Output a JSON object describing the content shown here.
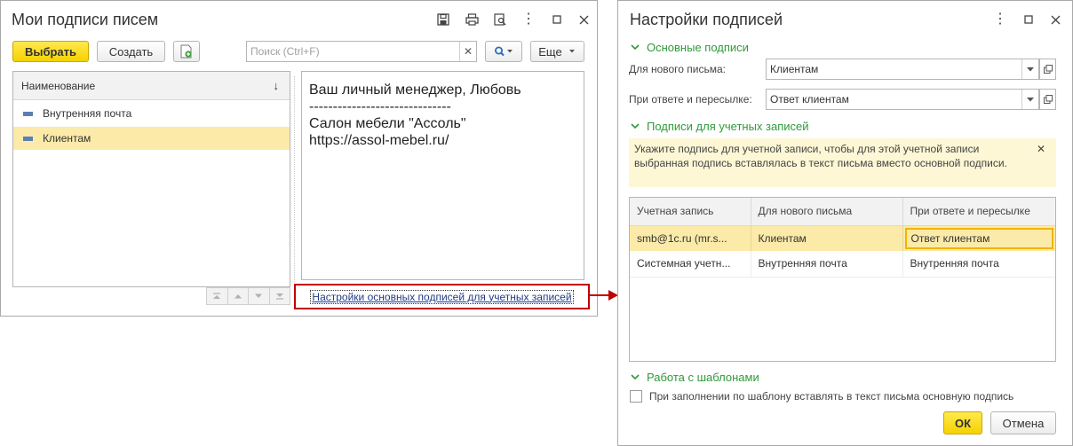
{
  "left_window": {
    "title": "Мои подписи писем",
    "toolbar": {
      "select_label": "Выбрать",
      "create_label": "Создать",
      "search_placeholder": "Поиск (Ctrl+F)",
      "more_label": "Еще"
    },
    "list": {
      "header": "Наименование",
      "items": [
        "Внутренняя почта",
        "Клиентам"
      ],
      "selected_index": 1
    },
    "preview": {
      "lines": [
        "Ваш личный менеджер, Любовь",
        "------------------------------",
        "Салон мебели \"Ассоль\"",
        "https://assol-mebel.ru/"
      ]
    },
    "settings_link": "Настройки основных подписей для учетных записей"
  },
  "right_window": {
    "title": "Настройки подписей",
    "sections": {
      "main": "Основные подписи",
      "accounts": "Подписи для учетных записей",
      "templates": "Работа с шаблонами"
    },
    "fields": {
      "new_letter_label": "Для нового письма:",
      "new_letter_value": "Клиентам",
      "reply_label": "При ответе и пересылке:",
      "reply_value": "Ответ клиентам"
    },
    "hint": "Укажите подпись для учетной записи, чтобы для этой учетной записи выбранная подпись вставлялась в текст письма вместо основной подписи.",
    "table": {
      "columns": [
        "Учетная запись",
        "Для нового письма",
        "При ответе и пересылке"
      ],
      "rows": [
        [
          "smb@1c.ru (mr.s...",
          "Клиентам",
          "Ответ клиентам"
        ],
        [
          "Системная учетн...",
          "Внутренняя почта",
          "Внутренняя почта"
        ]
      ]
    },
    "checkbox_label": "При заполнении по шаблону вставлять в текст письма основную подпись",
    "checkbox_checked": false,
    "ok_label": "ОК",
    "cancel_label": "Отмена"
  },
  "colors": {
    "accent_yellow": "#f5d200",
    "selected_row": "#fbeaa8",
    "section_green": "#2f9a3a",
    "highlight_red": "#c00000",
    "hint_bg": "#fdf7d5",
    "link_blue": "#1f3c88"
  }
}
